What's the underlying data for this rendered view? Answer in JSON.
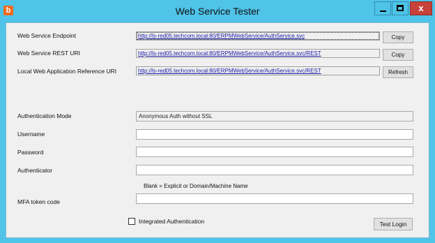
{
  "window": {
    "title": "Web Service Tester",
    "app_icon": "b",
    "close_glyph": "x",
    "accent_color": "#4fc3e8",
    "close_color": "#c7423a"
  },
  "endpoint": {
    "label": "Web Service Endpoint",
    "value": "http://ls-red05.techcom.local:80/ERPMWebService/AuthService.svc",
    "button": "Copy"
  },
  "rest": {
    "label": "Web Service REST URI",
    "value": "http://ls-red05.techcom.local:80/ERPMWebService/AuthService.svc/REST",
    "button": "Copy"
  },
  "local_ref": {
    "label": "Local Web Application Reference URI",
    "value": "http://ls-red05.techcom.local:80/ERPMWebService/AuthService.svc/REST",
    "button": "Refresh"
  },
  "auth_mode": {
    "label": "Authentication Mode",
    "value": "Anonymous Auth without SSL"
  },
  "username": {
    "label": "Username",
    "value": ""
  },
  "password": {
    "label": "Password",
    "value": ""
  },
  "authenticator": {
    "label": "Authenticator",
    "value": "",
    "hint": "Blank = Explicit or Domain/Machine Name"
  },
  "mfa": {
    "label": "MFA token code",
    "value": ""
  },
  "integrated_auth": {
    "label": "Integrated Authentication",
    "checked": false
  },
  "test_login_button": "Test Login"
}
